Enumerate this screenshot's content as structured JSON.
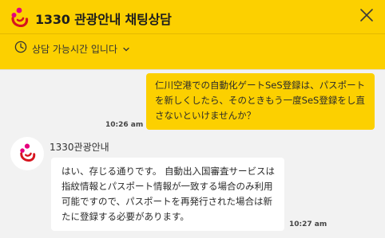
{
  "header": {
    "title": "1330 관광안내 채팅상담",
    "logo_icon": "tourism-logo-icon",
    "close_icon": "close-icon",
    "background_color": "#fcd000"
  },
  "hours": {
    "label": "상담 가능시간 입니다",
    "clock_icon": "clock-icon",
    "chevron_icon": "chevron-down-icon"
  },
  "messages": {
    "outgoing": {
      "text": "仁川空港での自動化ゲートSeS登録は、パスポートを新しくしたら、そのときもう一度SeS登録をし直さないといけませんか？",
      "time": "10:26 am",
      "bubble_color": "#fcd000"
    },
    "incoming": {
      "sender": "1330관광안내",
      "text": "はい、存じる通りです。 自動出入国審査サービスは指紋情報とパスポート情報が一致する場合のみ利用可能ですので、パスポートを再発行された場合は新たに登録する必要があります。",
      "time": "10:27 am",
      "avatar_icon": "tourism-logo-icon"
    }
  }
}
